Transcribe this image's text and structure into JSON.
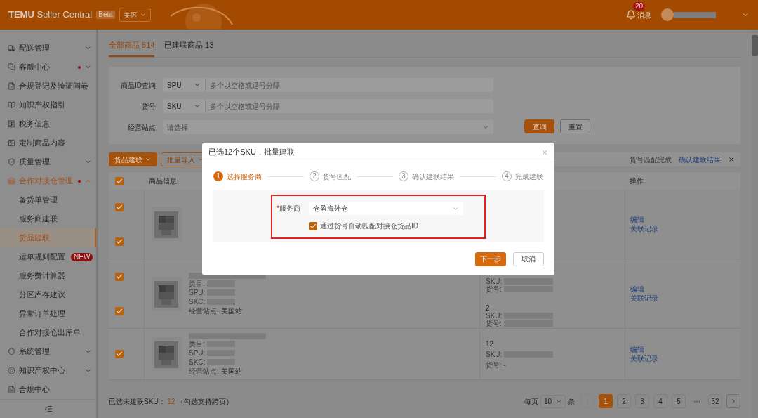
{
  "header": {
    "brand": "TEMU",
    "product": "Seller Central",
    "beta": "Beta",
    "region": "美区",
    "messages_label": "消息",
    "messages_count": "20"
  },
  "sidebar": {
    "items": [
      {
        "label": "配送管理",
        "dot": false,
        "expandable": true,
        "expanded": false,
        "selected": false
      },
      {
        "label": "客服中心",
        "dot": true,
        "expandable": true,
        "expanded": false,
        "selected": false
      },
      {
        "label": "合规登记及验证问卷",
        "dot": false,
        "expandable": false,
        "selected": false
      },
      {
        "label": "知识产权指引",
        "dot": false,
        "expandable": false,
        "selected": false
      },
      {
        "label": "税务信息",
        "dot": false,
        "expandable": false,
        "selected": false
      },
      {
        "label": "定制商品内容",
        "dot": false,
        "expandable": false,
        "selected": false
      },
      {
        "label": "质量管理",
        "dot": false,
        "expandable": true,
        "expanded": false,
        "selected": false
      },
      {
        "label": "合作对接仓管理",
        "dot": true,
        "expandable": true,
        "expanded": true,
        "selected": true,
        "children": [
          {
            "label": "备货单管理",
            "selected": false
          },
          {
            "label": "服务商建联",
            "selected": false
          },
          {
            "label": "货品建联",
            "selected": true
          },
          {
            "label": "运单规则配置",
            "selected": false,
            "badge": "NEW"
          },
          {
            "label": "服务费计算器",
            "selected": false
          },
          {
            "label": "分区库存建议",
            "selected": false
          },
          {
            "label": "异常订单处理",
            "selected": false
          },
          {
            "label": "合作对接仓出库单",
            "selected": false
          }
        ]
      },
      {
        "label": "系统管理",
        "dot": false,
        "expandable": true,
        "expanded": false,
        "selected": false
      },
      {
        "label": "知识产权中心",
        "dot": false,
        "expandable": true,
        "expanded": false,
        "selected": false
      },
      {
        "label": "合规中心",
        "dot": false,
        "expandable": false,
        "selected": false
      }
    ]
  },
  "tabs": [
    {
      "label": "全部商品 514",
      "selected": true
    },
    {
      "label": "已建联商品 13",
      "selected": false
    }
  ],
  "filters": {
    "rows": [
      {
        "label": "商品ID查询",
        "kind": "select_input",
        "select": "SPU",
        "placeholder": "多个以空格或逗号分隔"
      },
      {
        "label": "货号",
        "kind": "select_input",
        "select": "SKU",
        "placeholder": "多个以空格或逗号分隔"
      },
      {
        "label": "经营站点",
        "kind": "dropdown",
        "placeholder": "请选择"
      }
    ],
    "buttons": [
      {
        "label": "查询",
        "kind": "primary"
      },
      {
        "label": "重置",
        "kind": "default"
      }
    ]
  },
  "toolbar": {
    "buttons": [
      {
        "label": "货品建联",
        "kind": "primary"
      },
      {
        "label": "批量导入",
        "kind": "outline"
      }
    ],
    "notice": {
      "text": "货号匹配完成",
      "link": "确认建联结果"
    }
  },
  "table": {
    "all_checked": true,
    "columns": [
      {
        "label": "商品信息"
      },
      {
        "label": "操作"
      }
    ],
    "products": [
      {
        "skus": [
          {
            "checked": true
          },
          {
            "checked": true
          }
        ],
        "actions": [
          "编辑",
          "关联记录"
        ]
      },
      {
        "info": [
          {
            "label": "类目:",
            "redacted": true
          },
          {
            "label": "SPU:",
            "redacted": true
          },
          {
            "label": "SKC:",
            "redacted": true
          },
          {
            "label": "经营站点:",
            "value": "美国站",
            "redacted": false
          }
        ],
        "skus": [
          {
            "checked": true,
            "lines": [
              {
                "label": "SKU:",
                "redacted": true
              },
              {
                "label": "货号:",
                "redacted": true
              }
            ]
          },
          {
            "checked": true,
            "count": "2",
            "lines": [
              {
                "label": "SKU:",
                "redacted": true
              },
              {
                "label": "货号:",
                "redacted": true
              }
            ]
          }
        ],
        "actions": [
          "编辑",
          "关联记录"
        ]
      },
      {
        "info": [
          {
            "label": "类目:",
            "redacted": true
          },
          {
            "label": "SPU:",
            "redacted": true
          },
          {
            "label": "SKC:",
            "redacted": true
          },
          {
            "label": "经营站点:",
            "value": "美国站",
            "redacted": false
          }
        ],
        "skus": [
          {
            "checked": true,
            "count": "12",
            "lines": [
              {
                "label": "SKU:",
                "redacted": true
              },
              {
                "label": "货号: -",
                "redacted": false
              }
            ]
          }
        ],
        "actions": [
          "编辑",
          "关联记录"
        ]
      }
    ]
  },
  "footer": {
    "label": "已选未建联SKU：",
    "count": "12",
    "hint": "（勾选支持跨页）"
  },
  "pagination": {
    "per_page_label": "每页",
    "per_page": "10",
    "unit": "条",
    "prev_disabled": true,
    "next_disabled": false,
    "pages": [
      {
        "label": "1",
        "kind": "page",
        "selected": true
      },
      {
        "label": "2",
        "kind": "page",
        "selected": false
      },
      {
        "label": "3",
        "kind": "page",
        "selected": false
      },
      {
        "label": "4",
        "kind": "page",
        "selected": false
      },
      {
        "label": "5",
        "kind": "page",
        "selected": false
      },
      {
        "label": "···",
        "kind": "ellipsis"
      },
      {
        "label": "52",
        "kind": "page",
        "selected": false
      }
    ]
  },
  "modal": {
    "title": "已选12个SKU，批量建联",
    "steps": [
      {
        "number": "1",
        "label": "选择服务商",
        "selected": true
      },
      {
        "number": "2",
        "label": "货号匹配",
        "selected": false
      },
      {
        "number": "3",
        "label": "确认建联结果",
        "selected": false
      },
      {
        "number": "4",
        "label": "完成建联",
        "selected": false
      }
    ],
    "highlighted": true,
    "field": {
      "required": true,
      "required_mark": "*",
      "label": "服务商",
      "value": "仓盈海外仓"
    },
    "checkbox": {
      "label": "通过货号自动匹配对接仓货品ID",
      "checked": true
    },
    "buttons": [
      {
        "label": "下一步",
        "kind": "primary"
      },
      {
        "label": "取消",
        "kind": "default"
      }
    ]
  }
}
